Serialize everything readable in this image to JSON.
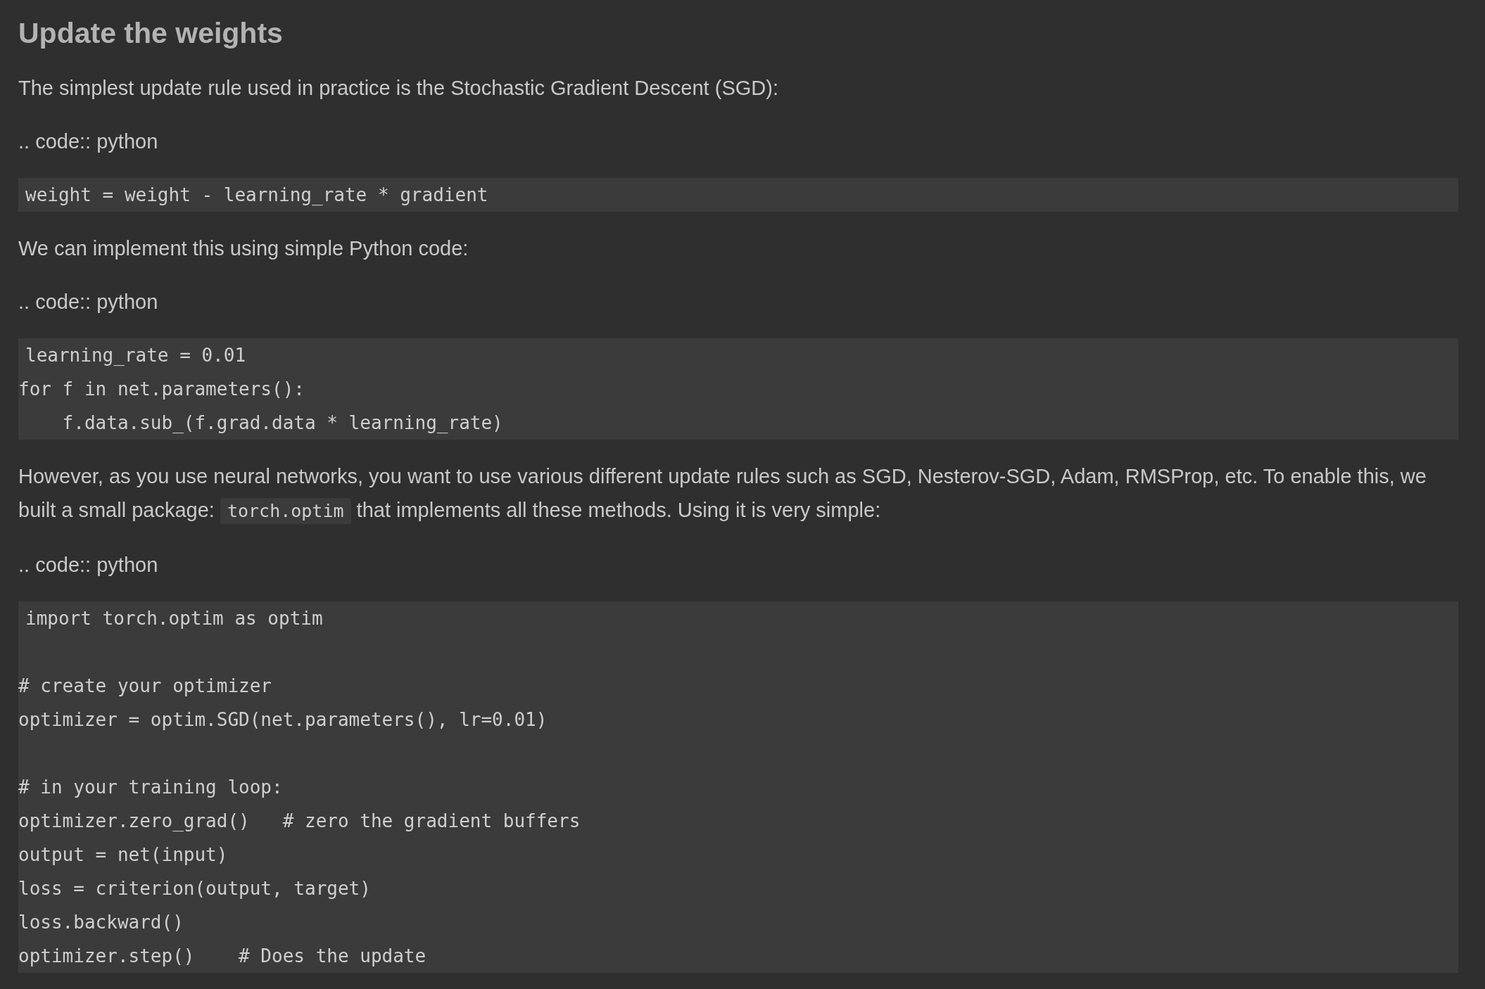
{
  "title": "Update the weights",
  "blocks": [
    {
      "kind": "paragraph",
      "lines": [
        [
          {
            "kind": "text",
            "text": "The simplest update rule used in practice is the Stochastic Gradient Descent (SGD):"
          }
        ]
      ]
    },
    {
      "kind": "directive",
      "text": ".. code:: python"
    },
    {
      "kind": "code",
      "groups": [
        [
          "weight = weight - learning_rate * gradient"
        ]
      ]
    },
    {
      "kind": "paragraph",
      "lines": [
        [
          {
            "kind": "text",
            "text": "We can implement this using simple Python code:"
          }
        ]
      ]
    },
    {
      "kind": "directive",
      "text": ".. code:: python"
    },
    {
      "kind": "code",
      "groups": [
        [
          "learning_rate = 0.01",
          "for f in net.parameters():",
          "    f.data.sub_(f.grad.data * learning_rate)"
        ]
      ]
    },
    {
      "kind": "paragraph",
      "lines": [
        [
          {
            "kind": "text",
            "text": "However, as you use neural networks, you want to use various different update rules such as SGD, Nesterov-SGD, Adam, RMSProp, etc. To enable this, we"
          }
        ],
        [
          {
            "kind": "text",
            "text": "built a small package:"
          },
          {
            "kind": "code",
            "text": "torch.optim"
          },
          {
            "kind": "text",
            "text": "that implements all these methods. Using it is very simple:"
          }
        ]
      ]
    },
    {
      "kind": "directive",
      "text": ".. code:: python"
    },
    {
      "kind": "code",
      "groups": [
        [
          "import torch.optim as optim"
        ],
        [
          "# create your optimizer",
          "optimizer = optim.SGD(net.parameters(), lr=0.01)"
        ],
        [
          "# in your training loop:",
          "optimizer.zero_grad()   # zero the gradient buffers",
          "output = net(input)",
          "loss = criterion(output, target)",
          "loss.backward()",
          "optimizer.step()    # Does the update"
        ]
      ]
    }
  ]
}
